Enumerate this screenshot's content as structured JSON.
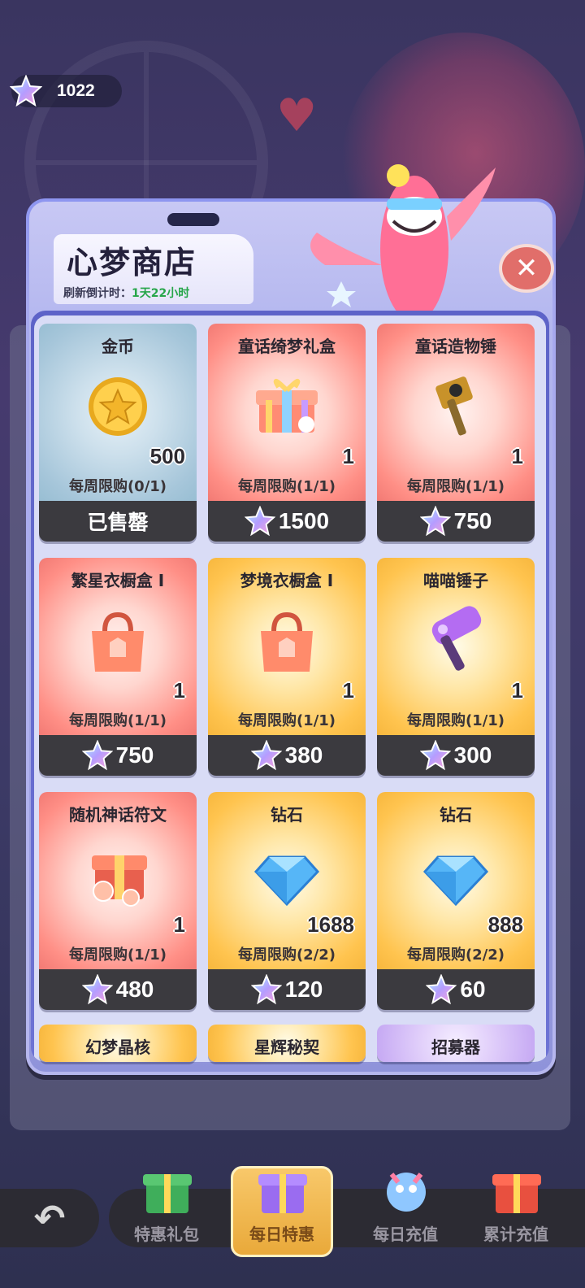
{
  "currency": {
    "amount": "1022",
    "icon": "star-crystal-icon"
  },
  "shop": {
    "title": "心梦商店",
    "refresh_label": "刷新倒计时：",
    "refresh_value": "1天22小时",
    "close_icon": "close-icon"
  },
  "items": [
    {
      "name": "金币",
      "qty": "500",
      "limit": "每周限购(0/1)",
      "price": "已售罄",
      "sold_out": true,
      "style": "blue",
      "icon": "gold-coin-icon"
    },
    {
      "name": "童话绮梦礼盒",
      "qty": "1",
      "limit": "每周限购(1/1)",
      "price": "1500",
      "style": "red",
      "icon": "gift-box-icon"
    },
    {
      "name": "童话造物锤",
      "qty": "1",
      "limit": "每周限购(1/1)",
      "price": "750",
      "style": "red",
      "icon": "hammer-icon"
    },
    {
      "name": "繁星衣橱盒 I",
      "qty": "1",
      "limit": "每周限购(1/1)",
      "price": "750",
      "style": "red",
      "icon": "wardrobe-bag-icon"
    },
    {
      "name": "梦境衣橱盒 I",
      "qty": "1",
      "limit": "每周限购(1/1)",
      "price": "380",
      "style": "yellow",
      "icon": "wardrobe-bag-icon"
    },
    {
      "name": "喵喵锤子",
      "qty": "1",
      "limit": "每周限购(1/1)",
      "price": "300",
      "style": "yellow",
      "icon": "purple-hammer-icon"
    },
    {
      "name": "随机神话符文",
      "qty": "1",
      "limit": "每周限购(1/1)",
      "price": "480",
      "style": "red",
      "icon": "rune-chest-icon"
    },
    {
      "name": "钻石",
      "qty": "1688",
      "limit": "每周限购(2/2)",
      "price": "120",
      "style": "yellow",
      "icon": "diamond-icon"
    },
    {
      "name": "钻石",
      "qty": "888",
      "limit": "每周限购(2/2)",
      "price": "60",
      "style": "yellow",
      "icon": "diamond-icon"
    }
  ],
  "partial_items": [
    {
      "name": "幻梦晶核",
      "style": "yellow"
    },
    {
      "name": "星辉秘契",
      "style": "yellow"
    },
    {
      "name": "招募器",
      "style": "purple"
    }
  ],
  "bottom_tabs": [
    {
      "label": "特惠礼包",
      "icon": "gift-pack-icon",
      "active": false
    },
    {
      "label": "每日特惠",
      "icon": "daily-deal-icon",
      "active": true
    },
    {
      "label": "每日充值",
      "icon": "daily-recharge-icon",
      "active": false
    },
    {
      "label": "累计充值",
      "icon": "cumulative-recharge-icon",
      "active": false
    }
  ],
  "back_icon": "back-arrow-icon"
}
